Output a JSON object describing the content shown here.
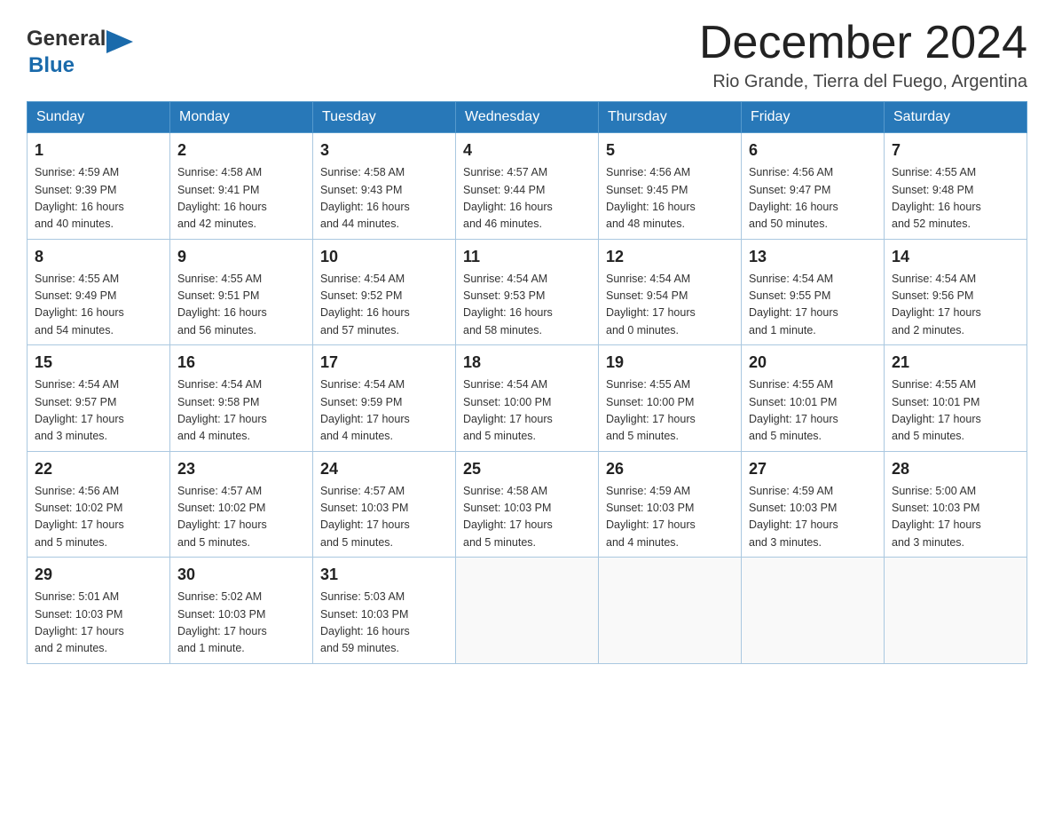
{
  "logo": {
    "text_general": "General",
    "text_blue": "Blue"
  },
  "title": {
    "month_year": "December 2024",
    "location": "Rio Grande, Tierra del Fuego, Argentina"
  },
  "weekdays": [
    "Sunday",
    "Monday",
    "Tuesday",
    "Wednesday",
    "Thursday",
    "Friday",
    "Saturday"
  ],
  "weeks": [
    [
      {
        "day": "1",
        "info": "Sunrise: 4:59 AM\nSunset: 9:39 PM\nDaylight: 16 hours\nand 40 minutes."
      },
      {
        "day": "2",
        "info": "Sunrise: 4:58 AM\nSunset: 9:41 PM\nDaylight: 16 hours\nand 42 minutes."
      },
      {
        "day": "3",
        "info": "Sunrise: 4:58 AM\nSunset: 9:43 PM\nDaylight: 16 hours\nand 44 minutes."
      },
      {
        "day": "4",
        "info": "Sunrise: 4:57 AM\nSunset: 9:44 PM\nDaylight: 16 hours\nand 46 minutes."
      },
      {
        "day": "5",
        "info": "Sunrise: 4:56 AM\nSunset: 9:45 PM\nDaylight: 16 hours\nand 48 minutes."
      },
      {
        "day": "6",
        "info": "Sunrise: 4:56 AM\nSunset: 9:47 PM\nDaylight: 16 hours\nand 50 minutes."
      },
      {
        "day": "7",
        "info": "Sunrise: 4:55 AM\nSunset: 9:48 PM\nDaylight: 16 hours\nand 52 minutes."
      }
    ],
    [
      {
        "day": "8",
        "info": "Sunrise: 4:55 AM\nSunset: 9:49 PM\nDaylight: 16 hours\nand 54 minutes."
      },
      {
        "day": "9",
        "info": "Sunrise: 4:55 AM\nSunset: 9:51 PM\nDaylight: 16 hours\nand 56 minutes."
      },
      {
        "day": "10",
        "info": "Sunrise: 4:54 AM\nSunset: 9:52 PM\nDaylight: 16 hours\nand 57 minutes."
      },
      {
        "day": "11",
        "info": "Sunrise: 4:54 AM\nSunset: 9:53 PM\nDaylight: 16 hours\nand 58 minutes."
      },
      {
        "day": "12",
        "info": "Sunrise: 4:54 AM\nSunset: 9:54 PM\nDaylight: 17 hours\nand 0 minutes."
      },
      {
        "day": "13",
        "info": "Sunrise: 4:54 AM\nSunset: 9:55 PM\nDaylight: 17 hours\nand 1 minute."
      },
      {
        "day": "14",
        "info": "Sunrise: 4:54 AM\nSunset: 9:56 PM\nDaylight: 17 hours\nand 2 minutes."
      }
    ],
    [
      {
        "day": "15",
        "info": "Sunrise: 4:54 AM\nSunset: 9:57 PM\nDaylight: 17 hours\nand 3 minutes."
      },
      {
        "day": "16",
        "info": "Sunrise: 4:54 AM\nSunset: 9:58 PM\nDaylight: 17 hours\nand 4 minutes."
      },
      {
        "day": "17",
        "info": "Sunrise: 4:54 AM\nSunset: 9:59 PM\nDaylight: 17 hours\nand 4 minutes."
      },
      {
        "day": "18",
        "info": "Sunrise: 4:54 AM\nSunset: 10:00 PM\nDaylight: 17 hours\nand 5 minutes."
      },
      {
        "day": "19",
        "info": "Sunrise: 4:55 AM\nSunset: 10:00 PM\nDaylight: 17 hours\nand 5 minutes."
      },
      {
        "day": "20",
        "info": "Sunrise: 4:55 AM\nSunset: 10:01 PM\nDaylight: 17 hours\nand 5 minutes."
      },
      {
        "day": "21",
        "info": "Sunrise: 4:55 AM\nSunset: 10:01 PM\nDaylight: 17 hours\nand 5 minutes."
      }
    ],
    [
      {
        "day": "22",
        "info": "Sunrise: 4:56 AM\nSunset: 10:02 PM\nDaylight: 17 hours\nand 5 minutes."
      },
      {
        "day": "23",
        "info": "Sunrise: 4:57 AM\nSunset: 10:02 PM\nDaylight: 17 hours\nand 5 minutes."
      },
      {
        "day": "24",
        "info": "Sunrise: 4:57 AM\nSunset: 10:03 PM\nDaylight: 17 hours\nand 5 minutes."
      },
      {
        "day": "25",
        "info": "Sunrise: 4:58 AM\nSunset: 10:03 PM\nDaylight: 17 hours\nand 5 minutes."
      },
      {
        "day": "26",
        "info": "Sunrise: 4:59 AM\nSunset: 10:03 PM\nDaylight: 17 hours\nand 4 minutes."
      },
      {
        "day": "27",
        "info": "Sunrise: 4:59 AM\nSunset: 10:03 PM\nDaylight: 17 hours\nand 3 minutes."
      },
      {
        "day": "28",
        "info": "Sunrise: 5:00 AM\nSunset: 10:03 PM\nDaylight: 17 hours\nand 3 minutes."
      }
    ],
    [
      {
        "day": "29",
        "info": "Sunrise: 5:01 AM\nSunset: 10:03 PM\nDaylight: 17 hours\nand 2 minutes."
      },
      {
        "day": "30",
        "info": "Sunrise: 5:02 AM\nSunset: 10:03 PM\nDaylight: 17 hours\nand 1 minute."
      },
      {
        "day": "31",
        "info": "Sunrise: 5:03 AM\nSunset: 10:03 PM\nDaylight: 16 hours\nand 59 minutes."
      },
      null,
      null,
      null,
      null
    ]
  ]
}
